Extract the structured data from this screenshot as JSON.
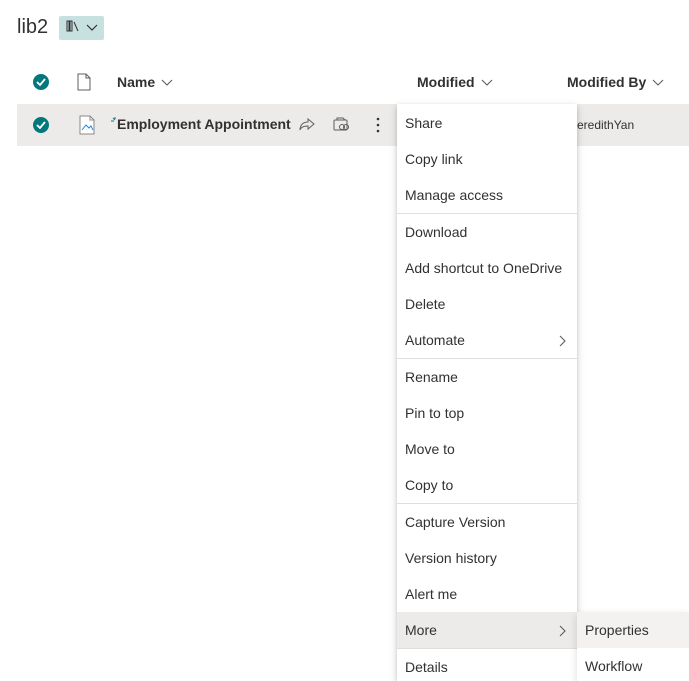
{
  "library": {
    "title": "lib2",
    "view_icon": "library-view-icon"
  },
  "columns": {
    "name": "Name",
    "modified": "Modified",
    "modified_by": "Modified By"
  },
  "row": {
    "file_name": "Employment Appointment",
    "modified_by": "eredithYan",
    "file_icon": "document-icon"
  },
  "menu": {
    "items": [
      {
        "label": "Share"
      },
      {
        "label": "Copy link"
      },
      {
        "label": "Manage access"
      },
      {
        "label": "Download"
      },
      {
        "label": "Add shortcut to OneDrive"
      },
      {
        "label": "Delete"
      },
      {
        "label": "Automate"
      },
      {
        "label": "Rename"
      },
      {
        "label": "Pin to top"
      },
      {
        "label": "Move to"
      },
      {
        "label": "Copy to"
      },
      {
        "label": "Capture Version"
      },
      {
        "label": "Version history"
      },
      {
        "label": "Alert me"
      },
      {
        "label": "More"
      },
      {
        "label": "Details"
      }
    ]
  },
  "submenu": {
    "items": [
      {
        "label": "Properties"
      },
      {
        "label": "Workflow"
      }
    ]
  },
  "colors": {
    "accent": "#03787c",
    "selected_row": "#edebe9",
    "view_switch_bg": "#c7e0e0"
  }
}
